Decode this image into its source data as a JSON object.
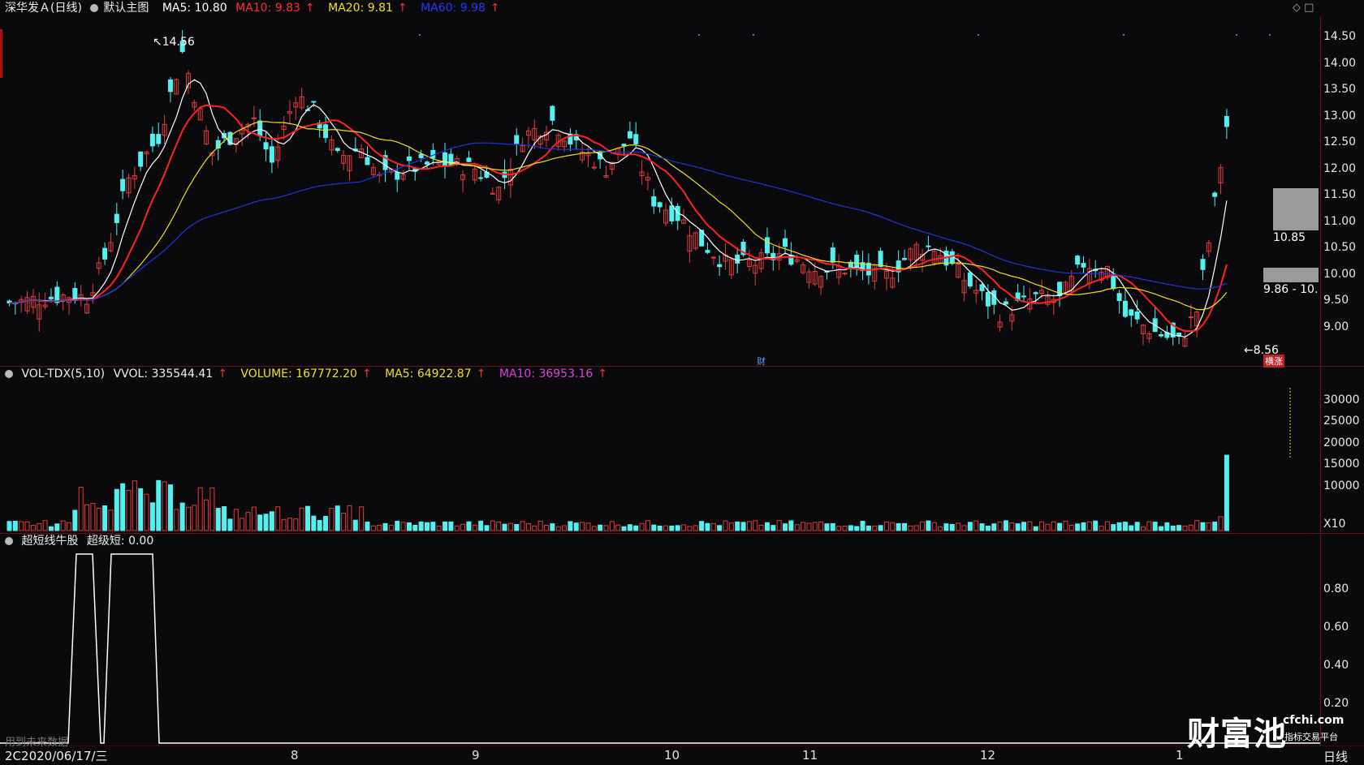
{
  "header": {
    "stock_name": "深华发Ａ(日线)",
    "main_chart_label": "默认主图",
    "ma5": "MA5: 10.80",
    "ma10": "MA10: 9.83",
    "ma20": "MA20: 9.81",
    "ma60": "MA60: 9.98",
    "arrow": "↑"
  },
  "price_axis": [
    "14.50",
    "14.00",
    "13.50",
    "13.00",
    "12.50",
    "12.00",
    "11.50",
    "11.00",
    "10.50",
    "10.00",
    "9.50",
    "9.00"
  ],
  "annotations": {
    "high": "14.56",
    "low": "8.56",
    "price_box_top": "10.85",
    "price_box_bottom": "9.86 - 10.",
    "cai_marker": "财",
    "zhangting_tag": "横涨"
  },
  "vol_header": {
    "label": "VOL-TDX(5,10)",
    "vvol": "VVOL: 335544.41",
    "volume": "VOLUME: 167772.20",
    "ma5": "MA5: 64922.87",
    "ma10": "MA10: 36953.16"
  },
  "vol_axis": [
    "30000",
    "25000",
    "20000",
    "15000",
    "10000",
    "X10"
  ],
  "ind_header": {
    "label": "超短线牛股",
    "value": "超级短: 0.00"
  },
  "ind_axis": [
    "0.80",
    "0.60",
    "0.40",
    "0.20"
  ],
  "footer": {
    "date": "2020/06/17/三",
    "date_prefix": "2C",
    "future_data": "用到未来数据",
    "period": "日线",
    "months": [
      "8",
      "9",
      "10",
      "11",
      "12",
      "1"
    ]
  },
  "watermark": {
    "brand": "财富池",
    "url": "cfchi.com",
    "tagline": "指标交易平台"
  },
  "colors": {
    "up": "#e33b3b",
    "down": "#54f0f0",
    "ma5": "#ffffff",
    "ma10": "#ff2222",
    "ma20": "#f0e020",
    "ma60": "#2233dd",
    "grid_border": "#7a1010"
  }
}
